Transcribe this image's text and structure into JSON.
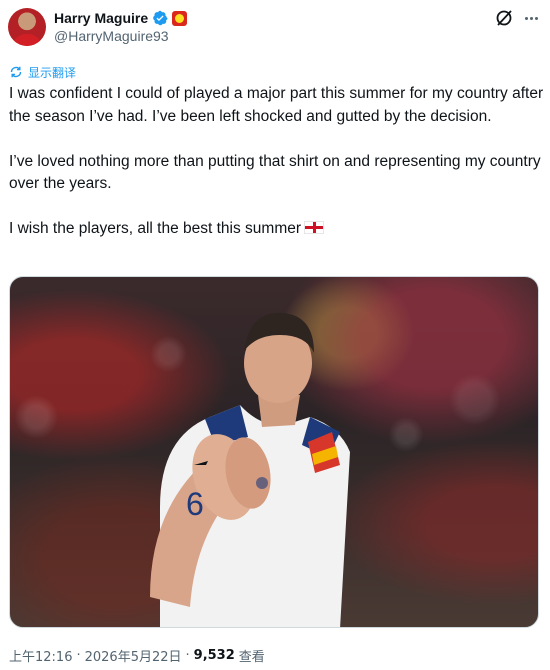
{
  "author": {
    "name": "Harry Maguire",
    "handle": "@HarryMaguire93"
  },
  "translate": {
    "label": "显示翻译"
  },
  "tweet": {
    "paragraphs": [
      "I was confident I could of played a major part this summer for my country after the season I’ve had. I’ve been left shocked and gutted by the decision.",
      "I’ve loved nothing more than putting that shirt on and representing my country over the years.",
      "I wish the players, all the best this summer"
    ]
  },
  "media": {
    "shirt_number": "6"
  },
  "footer": {
    "time": "上午12:16",
    "separator": "·",
    "date": "2026年5月22日",
    "views_count": "9,532",
    "views_label": "查看"
  },
  "colors": {
    "accent": "#1d9bf0",
    "text": "#0f1419",
    "muted": "#536471",
    "flag_red": "#ce1124"
  },
  "icons": [
    "verified-badge-icon",
    "club-badge-icon",
    "grok-icon",
    "more-icon",
    "translate-icon",
    "england-flag-icon"
  ]
}
